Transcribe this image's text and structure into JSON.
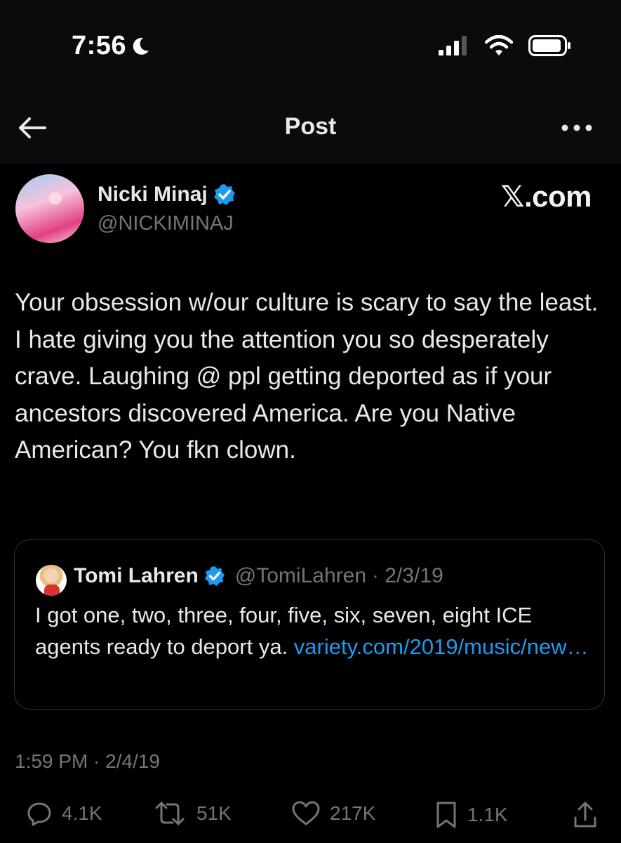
{
  "status_bar": {
    "time": "7:56"
  },
  "nav": {
    "title": "Post"
  },
  "author": {
    "name": "Nicki Minaj",
    "handle": "@NICKIMINAJ",
    "verified": true
  },
  "watermark": "𝕏.com",
  "tweet": {
    "text": "Your obsession w/our culture is scary to say the least. I hate giving you the attention you so desperately crave. Laughing @ ppl getting deported as if your ancestors discovered America. Are you Native American? You fkn clown."
  },
  "quoted": {
    "name": "Tomi Lahren",
    "handle": "@TomiLahren",
    "date": "· 2/3/19",
    "text": "I got one, two, three, four, five, six, seven, eight ICE agents ready to deport ya. ",
    "link": "variety.com/2019/music/new…"
  },
  "timestamp": "1:59 PM · 2/4/19",
  "actions": {
    "replies": "4.1K",
    "reposts": "51K",
    "likes": "217K",
    "bookmarks": "1.1K"
  },
  "colors": {
    "background": "#000000",
    "text": "#e7e9ea",
    "muted": "#71767b",
    "link": "#1d9bf0",
    "verified": "#1d9bf0"
  }
}
